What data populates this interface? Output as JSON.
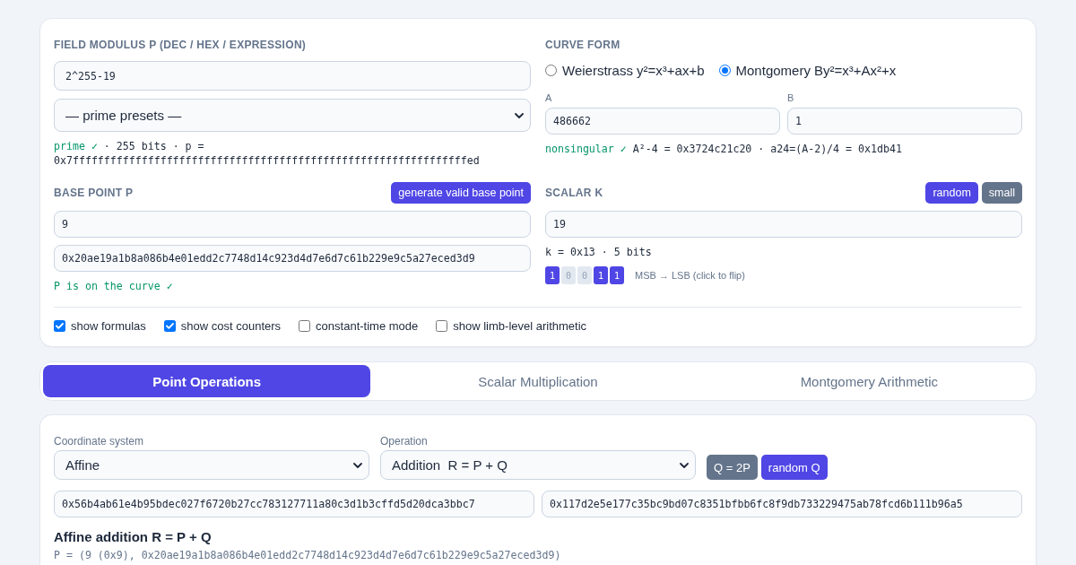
{
  "modulus": {
    "label": "FIELD MODULUS P (DEC / HEX / EXPRESSION)",
    "value": "2^255-19",
    "preset": "— prime presets —",
    "status": "prime ✓",
    "info": "· 255 bits · p =",
    "hex": "0x7fffffffffffffffffffffffffffffffffffffffffffffffffffffffffffffffed"
  },
  "curve": {
    "label": "CURVE FORM",
    "forms": [
      {
        "label": "Weierstrass y²=x³+ax+b",
        "selected": false
      },
      {
        "label": "Montgomery By²=x³+Ax²+x",
        "selected": true
      }
    ],
    "params": [
      {
        "label": "A",
        "value": "486662"
      },
      {
        "label": "B",
        "value": "1"
      }
    ],
    "status": "nonsingular ✓",
    "info": "A²-4 = 0x3724c21c20 · a24=(A-2)/4 = 0x1db41"
  },
  "base_point": {
    "label": "BASE POINT P",
    "button": "generate valid base point",
    "fields": [
      "9",
      "0x20ae19a1b8a086b4e01edd2c7748d14c923d4d7e6d7c61b229e9c5a27eced3d9"
    ],
    "status": "P is on the curve ✓"
  },
  "scalar": {
    "label": "SCALAR K",
    "buttons": [
      {
        "label": "random",
        "kind": "primary"
      },
      {
        "label": "small",
        "kind": "secondary"
      }
    ],
    "value": "19",
    "info": "k = 0x13 · 5 bits",
    "bits": [
      {
        "label": "1",
        "on": true
      },
      {
        "label": "0",
        "on": false
      },
      {
        "label": "0",
        "on": false
      },
      {
        "label": "1",
        "on": true
      },
      {
        "label": "1",
        "on": true
      }
    ],
    "hint": "MSB → LSB (click to flip)"
  },
  "options": [
    {
      "label": "show formulas",
      "checked": true
    },
    {
      "label": "show cost counters",
      "checked": true
    },
    {
      "label": "constant-time mode",
      "checked": false
    },
    {
      "label": "show limb-level arithmetic",
      "checked": false
    }
  ],
  "tabs": [
    {
      "label": "Point Operations",
      "selected": true
    },
    {
      "label": "Scalar Multiplication",
      "selected": false
    },
    {
      "label": "Montgomery Arithmetic",
      "selected": false
    }
  ],
  "operations": {
    "selects": [
      {
        "label": "Coordinate system",
        "value": "Affine"
      },
      {
        "label": "Operation",
        "value": "Addition  R = P + Q"
      }
    ],
    "buttons": [
      {
        "label": "Q = 2P",
        "kind": "secondary"
      },
      {
        "label": "random Q",
        "kind": "primary"
      }
    ],
    "q_fields": [
      "0x56b4ab61e4b95bdec027f6720b27cc783127711a80c3d1b3cffd5d20dca3bbc7",
      "0x117d2e5e177c35bc9bd07c8351bfbb6fc8f9db733229475ab78fcd6b111b96a5"
    ],
    "heading": "Affine addition R = P + Q",
    "formula": "P = (9 (0x9), 0x20ae19a1b8a086b4e01edd2c7748d14c923d4d7e6d7c61b229e9c5a27eced3d9)"
  }
}
